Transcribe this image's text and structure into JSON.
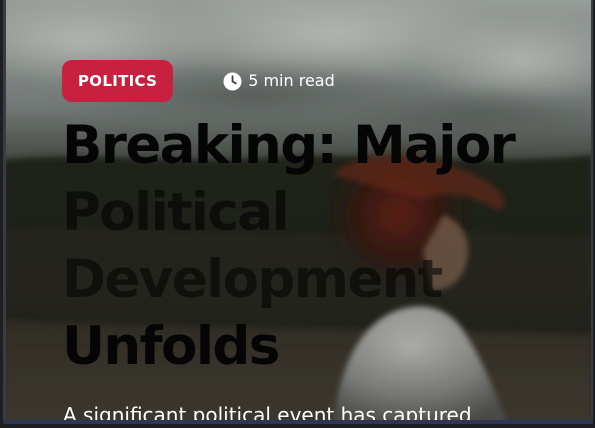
{
  "article": {
    "category": "POLITICS",
    "read_time": "5 min read",
    "headline_lines": [
      "Breaking: Major",
      "Political",
      "Development",
      "Unfolds"
    ],
    "excerpt": "A significant political event has captured"
  },
  "icons": {
    "read_time_icon": "clock-icon"
  },
  "colors": {
    "badge_background": "#c8203f",
    "badge_text": "#ffffff",
    "headline": "#000000",
    "meta_text": "#ffffff"
  }
}
